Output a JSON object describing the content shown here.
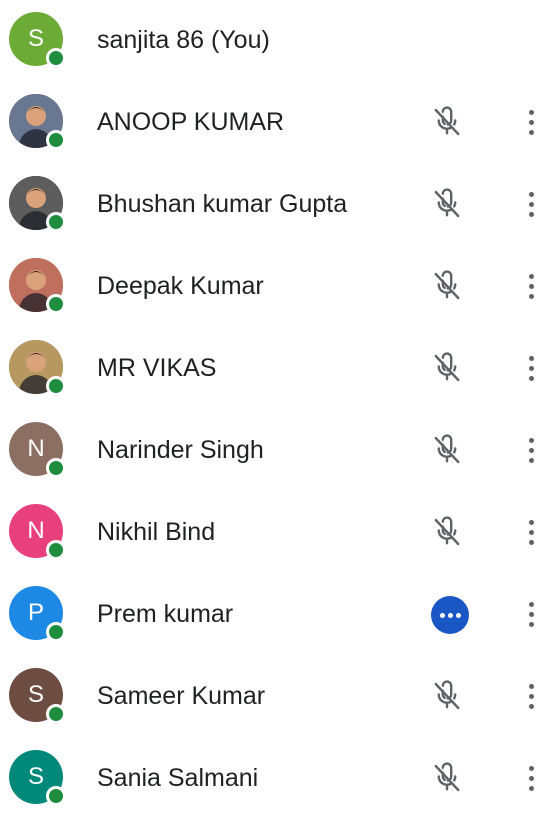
{
  "participants": [
    {
      "name": "sanjita 86 (You)",
      "avatar_type": "initial",
      "initial": "S",
      "avatar_color": "#6cab36",
      "status": "none"
    },
    {
      "name": "ANOOP KUMAR",
      "avatar_type": "photo",
      "avatar_color": "#4a5a78",
      "status": "muted"
    },
    {
      "name": "Bhushan kumar Gupta",
      "avatar_type": "photo",
      "avatar_color": "#3a3a3a",
      "status": "muted"
    },
    {
      "name": "Deepak Kumar",
      "avatar_type": "photo",
      "avatar_color": "#b0503a",
      "status": "muted"
    },
    {
      "name": "MR VIKAS",
      "avatar_type": "photo",
      "avatar_color": "#a8823e",
      "status": "muted"
    },
    {
      "name": "Narinder Singh",
      "avatar_type": "initial",
      "initial": "N",
      "avatar_color": "#8d6e63",
      "status": "muted"
    },
    {
      "name": "Nikhil Bind",
      "avatar_type": "initial",
      "initial": "N",
      "avatar_color": "#e8407a",
      "status": "muted"
    },
    {
      "name": "Prem kumar",
      "avatar_type": "initial",
      "initial": "P",
      "avatar_color": "#1e88e5",
      "status": "speaking"
    },
    {
      "name": "Sameer Kumar",
      "avatar_type": "initial",
      "initial": "S",
      "avatar_color": "#6d4c41",
      "status": "muted"
    },
    {
      "name": "Sania Salmani",
      "avatar_type": "initial",
      "initial": "S",
      "avatar_color": "#00897b",
      "status": "muted"
    }
  ],
  "colors": {
    "presence": "#1e8e3e",
    "speaking_indicator": "#1a56c4",
    "icon_gray": "#5f6368"
  },
  "icons": {
    "mic_status": "mic-off-icon",
    "speaking": "speaking-dots-icon",
    "more": "more-vert-icon"
  }
}
